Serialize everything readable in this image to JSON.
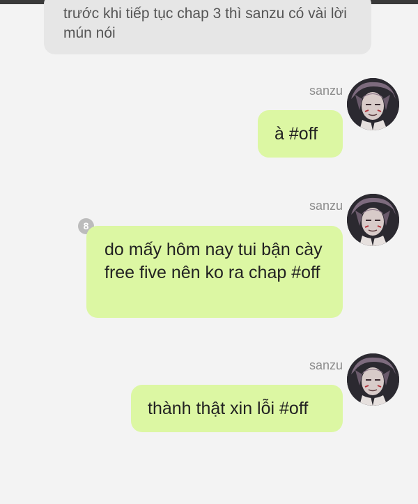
{
  "incoming_message": {
    "text": "trước khi tiếp tục chap 3 thì sanzu có vài lời mún nói"
  },
  "messages": [
    {
      "sender": "sanzu",
      "text": "à #off",
      "avatar_icon": "character-avatar"
    },
    {
      "sender": "sanzu",
      "text": "do mấy hôm nay tui bận cày free five nên ko ra chap #off",
      "badge": "8",
      "avatar_icon": "character-avatar"
    },
    {
      "sender": "sanzu",
      "text": "thành thật xin lỗi #off",
      "avatar_icon": "character-avatar"
    }
  ],
  "colors": {
    "outgoing_bubble": "#dcf7a3",
    "incoming_bubble": "#e6e6e6",
    "background": "#f3f3f3",
    "sender_name": "#8c8c8c",
    "badge": "#bcbcbc"
  }
}
